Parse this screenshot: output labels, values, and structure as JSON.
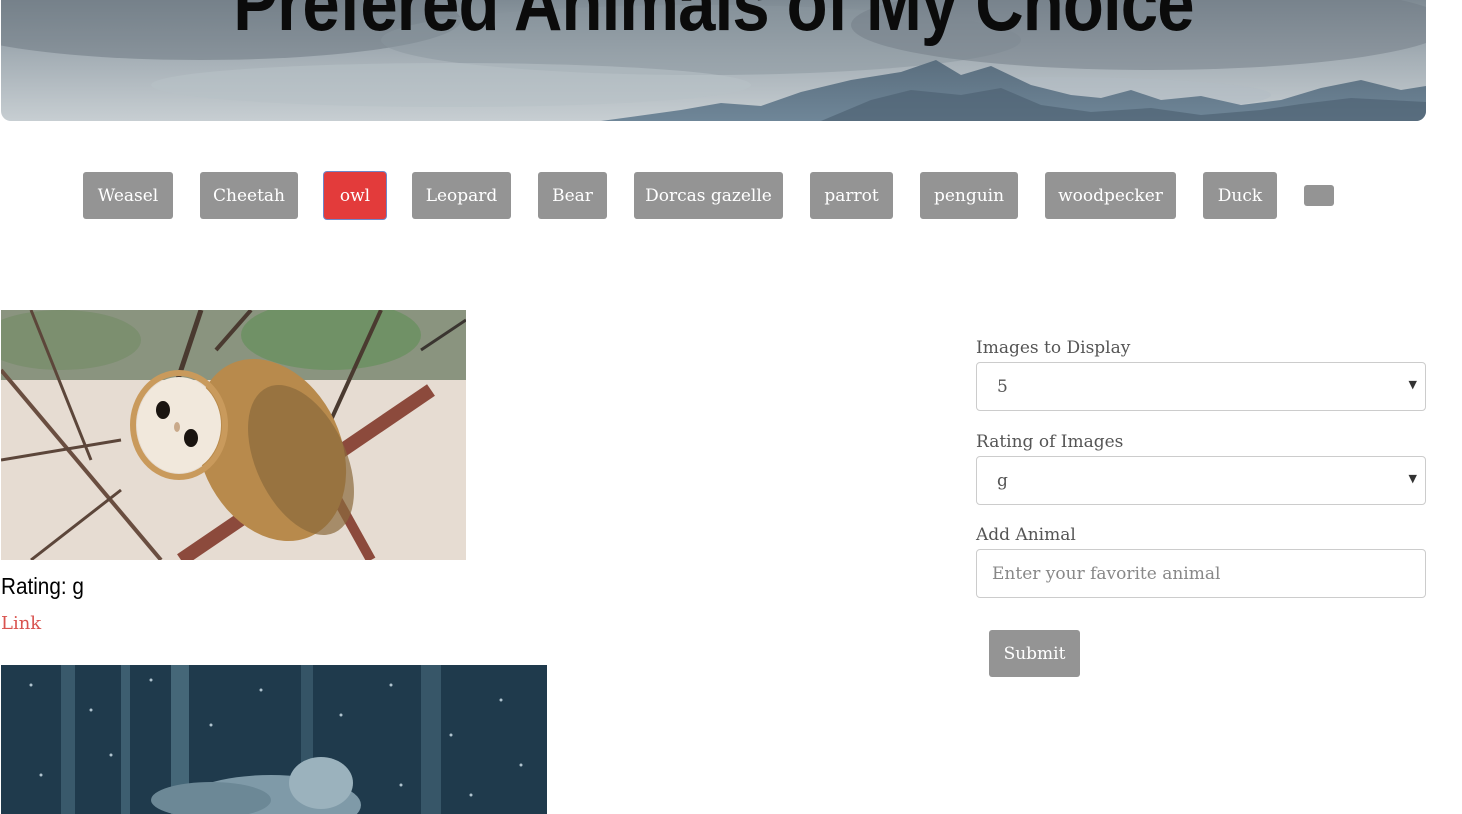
{
  "header": {
    "title": "Prefered Animals of My Choice"
  },
  "animal_buttons": [
    {
      "label": "Weasel",
      "active": false
    },
    {
      "label": "Cheetah",
      "active": false
    },
    {
      "label": "owl",
      "active": true
    },
    {
      "label": "Leopard",
      "active": false
    },
    {
      "label": "Bear",
      "active": false
    },
    {
      "label": "Dorcas gazelle",
      "active": false
    },
    {
      "label": "parrot",
      "active": false
    },
    {
      "label": "penguin",
      "active": false
    },
    {
      "label": "woodpecker",
      "active": false
    },
    {
      "label": "Duck",
      "active": false
    },
    {
      "label": "",
      "active": false
    }
  ],
  "results": [
    {
      "rating_text": "Rating: g",
      "link_label": "Link",
      "image": "barn-owl-on-branch"
    },
    {
      "image": "owl-in-snow"
    }
  ],
  "form": {
    "images_label": "Images to Display",
    "images_value": "5",
    "rating_label": "Rating of Images",
    "rating_value": "g",
    "add_label": "Add Animal",
    "add_placeholder": "Enter your favorite animal",
    "submit_label": "Submit"
  },
  "colors": {
    "button_gray": "#949494",
    "button_active": "#e33b3b",
    "link_red": "#d9534f"
  }
}
